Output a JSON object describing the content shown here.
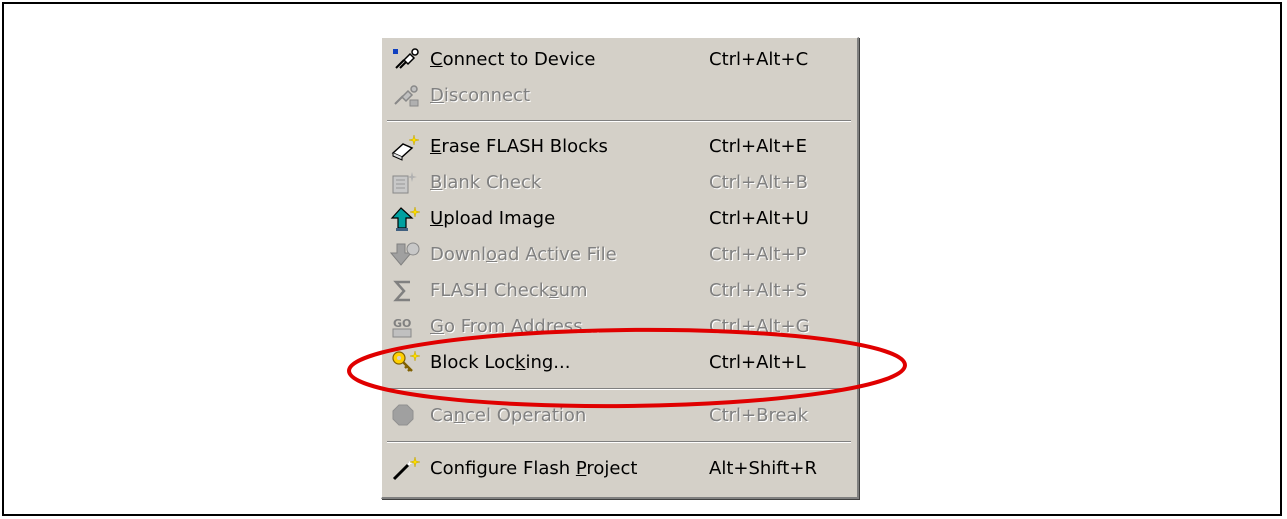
{
  "menu": {
    "items": [
      {
        "id": "connect",
        "pre": "",
        "u": "C",
        "post": "onnect to Device",
        "shortcut": "Ctrl+Alt+C",
        "disabled": false,
        "icon": "plug-connect-icon"
      },
      {
        "id": "disconnect",
        "pre": "",
        "u": "D",
        "post": "isconnect",
        "shortcut": "",
        "disabled": true,
        "icon": "plug-disconnect-icon"
      },
      {
        "id": "erase",
        "pre": "",
        "u": "E",
        "post": "rase FLASH Blocks",
        "shortcut": "Ctrl+Alt+E",
        "disabled": false,
        "icon": "eraser-icon"
      },
      {
        "id": "blank",
        "pre": "",
        "u": "B",
        "post": "lank Check",
        "shortcut": "Ctrl+Alt+B",
        "disabled": true,
        "icon": "blank-check-icon"
      },
      {
        "id": "upload",
        "pre": "",
        "u": "U",
        "post": "pload Image",
        "shortcut": "Ctrl+Alt+U",
        "disabled": false,
        "icon": "upload-arrow-icon"
      },
      {
        "id": "download",
        "pre": "Downl",
        "u": "o",
        "post": "ad Active File",
        "shortcut": "Ctrl+Alt+P",
        "disabled": true,
        "icon": "download-arrow-icon"
      },
      {
        "id": "checksum",
        "pre": "FLASH Check",
        "u": "s",
        "post": "um",
        "shortcut": "Ctrl+Alt+S",
        "disabled": true,
        "icon": "sigma-icon"
      },
      {
        "id": "goaddr",
        "pre": "",
        "u": "G",
        "post": "o From Address...",
        "shortcut": "Ctrl+Alt+G",
        "disabled": true,
        "icon": "go-icon"
      },
      {
        "id": "blocklock",
        "pre": "Block Loc",
        "u": "k",
        "post": "ing...",
        "shortcut": "Ctrl+Alt+L",
        "disabled": false,
        "icon": "key-lock-icon"
      },
      {
        "id": "cancel",
        "pre": "Ca",
        "u": "n",
        "post": "cel Operation",
        "shortcut": "Ctrl+Break",
        "disabled": true,
        "icon": "stop-octagon-icon"
      },
      {
        "id": "configure",
        "pre": "Configure Flash ",
        "u": "P",
        "post": "roject",
        "shortcut": "Alt+Shift+R",
        "disabled": false,
        "icon": "magic-wand-icon"
      }
    ]
  },
  "colors": {
    "menu_bg": "#d4d0c8",
    "disabled_text": "#808080",
    "highlight_ellipse": "#e00000"
  }
}
